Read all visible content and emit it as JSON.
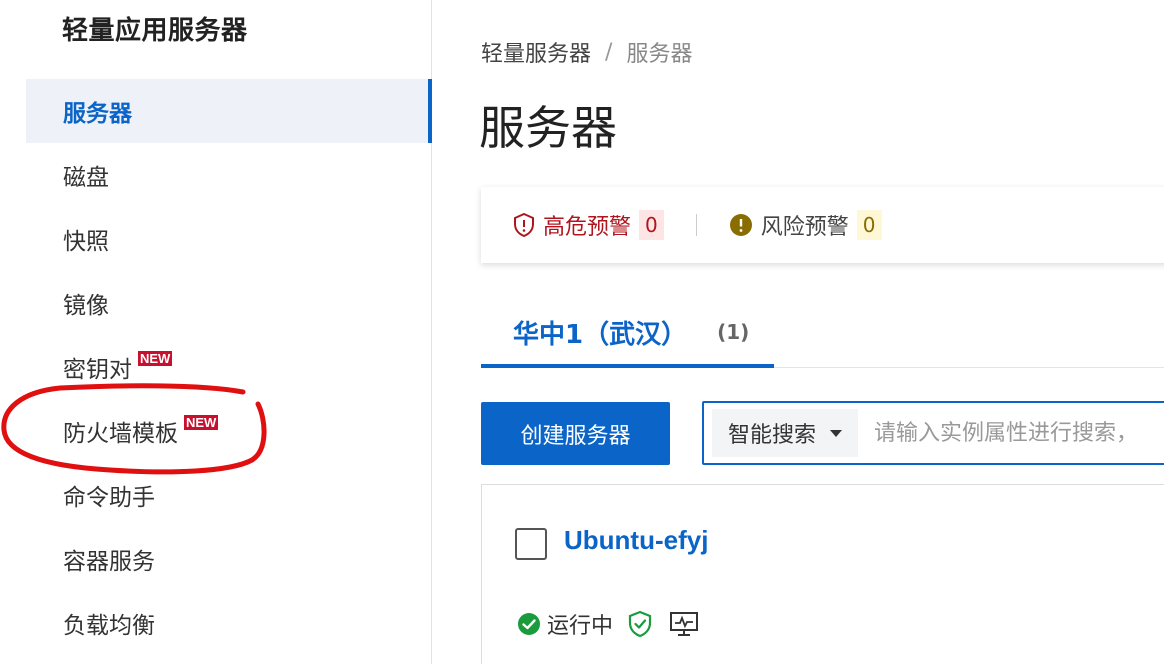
{
  "sidebar": {
    "title": "轻量应用服务器",
    "items": [
      {
        "label": "服务器",
        "active": true
      },
      {
        "label": "磁盘"
      },
      {
        "label": "快照"
      },
      {
        "label": "镜像"
      },
      {
        "label": "密钥对",
        "badge": "NEW"
      },
      {
        "label": "防火墙模板",
        "badge": "NEW"
      },
      {
        "label": "命令助手"
      },
      {
        "label": "容器服务"
      },
      {
        "label": "负载均衡"
      }
    ]
  },
  "breadcrumb": {
    "root": "轻量服务器",
    "separator": "/",
    "current": "服务器"
  },
  "page_title": "服务器",
  "alerts": {
    "high": {
      "label": "高危预警",
      "count": "0",
      "icon": "shield-warning-icon"
    },
    "risk": {
      "label": "风险预警",
      "count": "0",
      "icon": "exclamation-circle-icon"
    }
  },
  "tabs": [
    {
      "label": "华中1（武汉）",
      "count": "(1)"
    }
  ],
  "toolbar": {
    "create_label": "创建服务器",
    "search_type": "智能搜索",
    "search_placeholder": "请输入实例属性进行搜索，"
  },
  "server": {
    "name": "Ubuntu-efyj",
    "status": "运行中",
    "status_icon": "check-circle-icon",
    "icons": [
      "shield-check-icon",
      "monitor-icon"
    ]
  },
  "colors": {
    "accent": "#0b64c8",
    "danger": "#b0151e",
    "warning": "#8a6d00",
    "success": "#1a9b3c",
    "annotation": "#e01010"
  }
}
